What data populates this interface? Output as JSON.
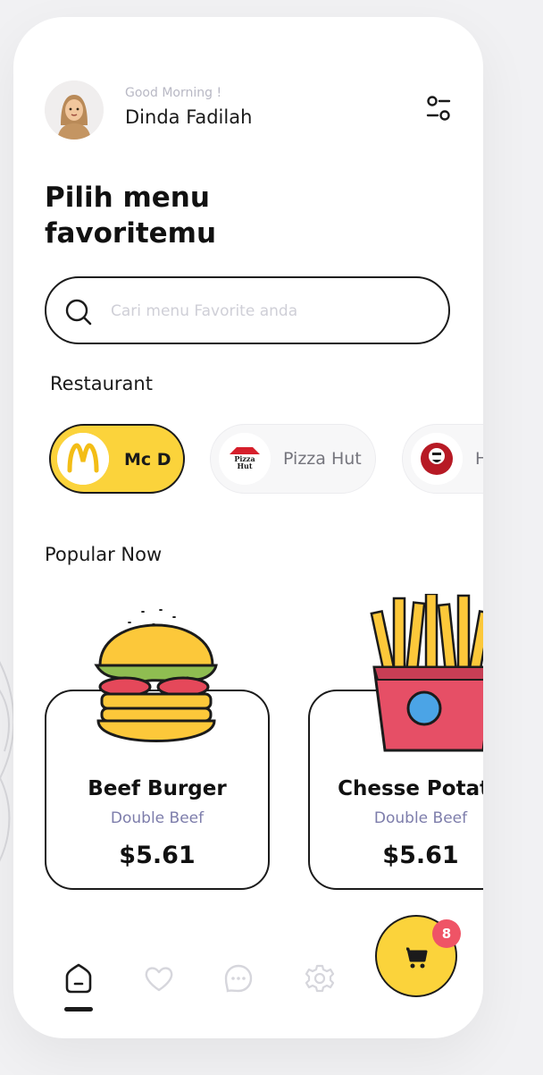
{
  "header": {
    "greeting": "Good Morning !",
    "user_name": "Dinda Fadilah"
  },
  "title": "Pilih menu favoritemu",
  "search": {
    "placeholder": "Cari menu Favorite anda",
    "value": ""
  },
  "restaurants": {
    "label": "Restaurant",
    "items": [
      {
        "name": "Mc D",
        "logo_text": "M",
        "selected": true
      },
      {
        "name": "Pizza Hut",
        "logo_text": "Pizza Hut",
        "selected": false
      },
      {
        "name": "H",
        "logo_text": "KFC",
        "selected": false
      }
    ]
  },
  "popular": {
    "label": "Popular Now",
    "items": [
      {
        "name": "Beef Burger",
        "subtitle": "Double Beef",
        "price": "$5.61"
      },
      {
        "name": "Chesse Potato",
        "subtitle": "Double Beef",
        "price": "$5.61"
      }
    ]
  },
  "nav": {
    "items": [
      "home-icon",
      "heart-icon",
      "chat-icon",
      "settings-icon"
    ],
    "active": "home"
  },
  "cart": {
    "count": "8"
  },
  "colors": {
    "accent_yellow": "#fbd33b",
    "badge_red": "#ef5466",
    "subtitle_purple": "#7d7dab"
  }
}
